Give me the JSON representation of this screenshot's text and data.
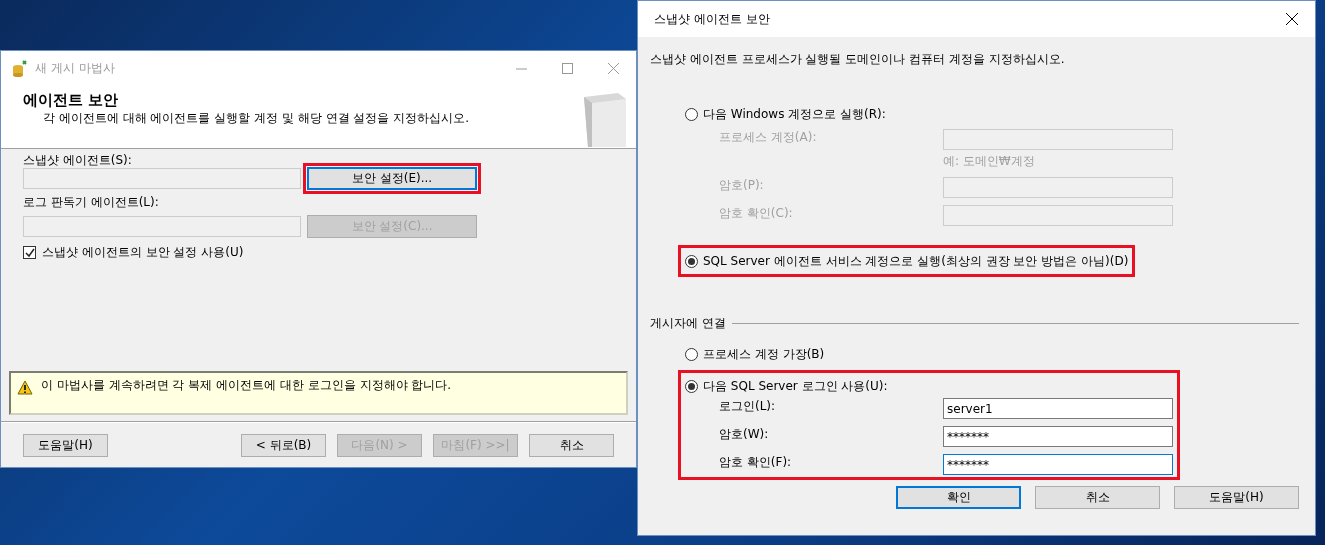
{
  "wizard": {
    "title": "새 게시 마법사",
    "header": {
      "title": "에이전트 보안",
      "subtitle": "각 에이전트에 대해 에이전트를 실행할 계정 및 해당 연결 설정을 지정하십시오."
    },
    "agents": [
      {
        "label": "스냅샷 에이전트(S):",
        "button": {
          "label": "보안 설정(E)...",
          "disabled": false,
          "highlighted": true
        }
      },
      {
        "label": "로그 판독기 에이전트(L):",
        "button": {
          "label": "보안 설정(C)...",
          "disabled": true,
          "highlighted": false
        }
      }
    ],
    "use_snapshot_settings": {
      "label": "스냅샷 에이전트의 보안 설정 사용(U)",
      "checked": true
    },
    "warning": "이 마법사를 계속하려면 각 복제 에이전트에 대한 로그인을 지정해야 합니다.",
    "buttons": [
      {
        "label": "도움말(H)",
        "disabled": false
      },
      {
        "label": "< 뒤로(B)",
        "disabled": false
      },
      {
        "label": "다음(N) >",
        "disabled": true
      },
      {
        "label": "마침(F) >>|",
        "disabled": true
      },
      {
        "label": "취소",
        "disabled": false
      }
    ]
  },
  "dialog": {
    "title": "스냅샷 에이전트 보안",
    "instruction": "스냅샷 에이전트 프로세스가 실행될 도메인이나 컴퓨터 계정을 지정하십시오.",
    "run_as": [
      {
        "label": "다음 Windows 계정으로 실행(R):",
        "selected": false,
        "highlighted": false,
        "fields": [
          {
            "label": "프로세스 계정(A):",
            "hint": "예: 도메인₩계정"
          },
          {
            "label": "암호(P):"
          },
          {
            "label": "암호 확인(C):"
          }
        ]
      },
      {
        "label": "SQL Server 에이전트 서비스 계정으로 실행(최상의 권장 보안 방법은 아님)(D)",
        "selected": true,
        "highlighted": true
      }
    ],
    "connect": {
      "title": "게시자에 연결",
      "options": [
        {
          "label": "프로세스 계정 가장(B)",
          "selected": false,
          "highlighted": false
        },
        {
          "label": "다음 SQL Server 로그인 사용(U):",
          "selected": true,
          "highlighted": true,
          "fields": [
            {
              "label": "로그인(L):",
              "value": "server1"
            },
            {
              "label": "암호(W):",
              "value": "*******"
            },
            {
              "label": "암호 확인(F):",
              "value": "*******",
              "focused": true
            }
          ]
        }
      ]
    },
    "buttons": [
      {
        "label": "확인",
        "default": true
      },
      {
        "label": "취소",
        "default": false
      },
      {
        "label": "도움말(H)",
        "default": false
      }
    ]
  }
}
